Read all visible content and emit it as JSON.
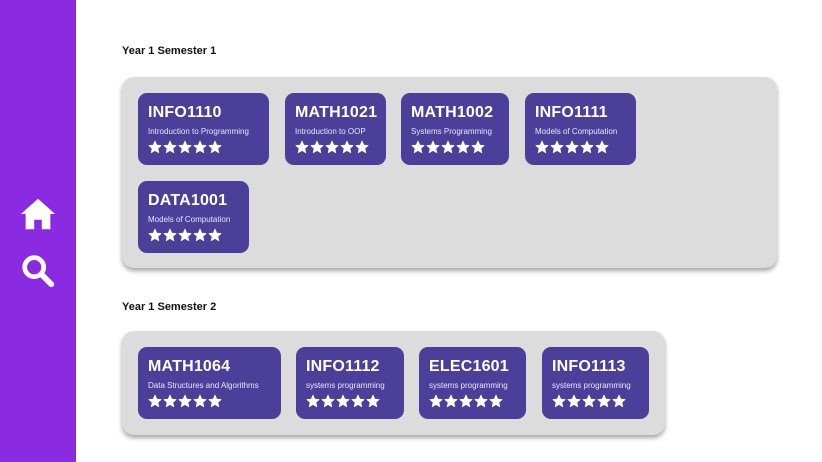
{
  "sidebar": {
    "items": [
      {
        "icon": "home-icon",
        "label": ""
      },
      {
        "icon": "search-icon",
        "label": ""
      }
    ]
  },
  "colors": {
    "sidebar": "#8a2be2",
    "card": "#4b3f99",
    "panel": "#dcdcdc"
  },
  "semesters": [
    {
      "title": "Year 1 Semester 1",
      "courses": [
        {
          "code": "INFO1110",
          "name": "Introduction to Programming",
          "rating": 5
        },
        {
          "code": "MATH1021",
          "name": "Introduction to OOP",
          "rating": 5
        },
        {
          "code": "MATH1002",
          "name": "Systems Programming",
          "rating": 5
        },
        {
          "code": "INFO1111",
          "name": "Models of Computation",
          "rating": 5
        },
        {
          "code": "DATA1001",
          "name": "Models of Computation",
          "rating": 5
        }
      ]
    },
    {
      "title": "Year 1 Semester 2",
      "courses": [
        {
          "code": "MATH1064",
          "name": "Data Structures and Algorithms",
          "rating": 5
        },
        {
          "code": "INFO1112",
          "name": "systems programming",
          "rating": 5
        },
        {
          "code": "ELEC1601",
          "name": "systems programming",
          "rating": 5
        },
        {
          "code": "INFO1113",
          "name": "systems programming",
          "rating": 5
        }
      ]
    }
  ]
}
